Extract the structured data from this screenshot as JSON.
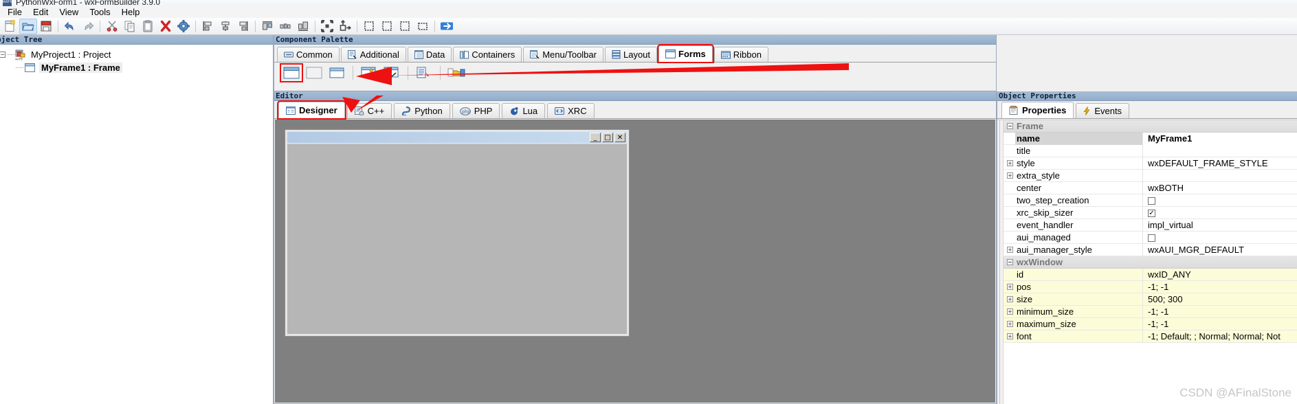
{
  "window": {
    "title": "PythonWxForm1 - wxFormBuilder 3.9.0",
    "app_icon": "wxfb-icon"
  },
  "menubar": {
    "items": [
      {
        "label": "File"
      },
      {
        "label": "Edit"
      },
      {
        "label": "View"
      },
      {
        "label": "Tools"
      },
      {
        "label": "Help"
      }
    ]
  },
  "toolbar": {
    "buttons": [
      {
        "name": "new-project",
        "icon": "new-document-icon",
        "selected": false
      },
      {
        "name": "open-project",
        "icon": "open-folder-icon",
        "selected": true
      },
      {
        "name": "save-project",
        "icon": "save-floppy-icon",
        "selected": false
      },
      {
        "name": "undo",
        "icon": "undo-arrow-icon",
        "selected": false
      },
      {
        "name": "redo",
        "icon": "redo-arrow-icon",
        "selected": false
      },
      {
        "name": "cut",
        "icon": "scissors-icon",
        "selected": false
      },
      {
        "name": "copy",
        "icon": "copy-icon",
        "selected": false
      },
      {
        "name": "paste",
        "icon": "clipboard-icon",
        "selected": false
      },
      {
        "name": "delete",
        "icon": "red-x-icon",
        "selected": false
      },
      {
        "name": "generate-code",
        "icon": "gear-icon",
        "selected": false
      },
      {
        "name": "align-left",
        "icon": "align-left-icon",
        "selected": false
      },
      {
        "name": "align-center-vertical",
        "icon": "align-center-vertical-icon",
        "selected": false
      },
      {
        "name": "align-right",
        "icon": "align-right-icon",
        "selected": false
      },
      {
        "name": "align-top",
        "icon": "align-top-icon",
        "selected": false
      },
      {
        "name": "align-center-horizontal",
        "icon": "align-center-horizontal-icon",
        "selected": false
      },
      {
        "name": "align-bottom",
        "icon": "align-bottom-icon",
        "selected": false
      },
      {
        "name": "expand-all",
        "icon": "expand-arrows-icon",
        "selected": false
      },
      {
        "name": "move-up",
        "icon": "move-object-icon",
        "selected": false
      },
      {
        "name": "border-left",
        "icon": "dotted-border-left-icon",
        "selected": false
      },
      {
        "name": "border-right",
        "icon": "dotted-border-right-icon",
        "selected": false
      },
      {
        "name": "border-top",
        "icon": "dotted-border-top-icon",
        "selected": false
      },
      {
        "name": "border-bottom",
        "icon": "dotted-border-bottom-icon",
        "selected": false
      },
      {
        "name": "preview-form",
        "icon": "blue-arrow-icon",
        "selected": false
      }
    ]
  },
  "object_tree": {
    "caption": "bject Tree",
    "nodes": [
      {
        "label": "MyProject1 : Project",
        "icon": "wxfb-project-icon",
        "expanded": true,
        "selected": false
      },
      {
        "label": "MyFrame1 : Frame",
        "icon": "frame-icon",
        "expanded": false,
        "selected": true
      }
    ]
  },
  "component_palette": {
    "caption": "Component Palette",
    "tabs": [
      {
        "label": "Common",
        "icon": "common-icon",
        "active": false,
        "highlighted": false
      },
      {
        "label": "Additional",
        "icon": "additional-icon",
        "active": false,
        "highlighted": false
      },
      {
        "label": "Data",
        "icon": "data-icon",
        "active": false,
        "highlighted": false
      },
      {
        "label": "Containers",
        "icon": "containers-icon",
        "active": false,
        "highlighted": false
      },
      {
        "label": "Menu/Toolbar",
        "icon": "menu-toolbar-icon",
        "active": false,
        "highlighted": false
      },
      {
        "label": "Layout",
        "icon": "layout-icon",
        "active": false,
        "highlighted": false
      },
      {
        "label": "Forms",
        "icon": "forms-icon",
        "active": true,
        "highlighted": true
      },
      {
        "label": "Ribbon",
        "icon": "ribbon-icon",
        "active": false,
        "highlighted": false
      }
    ],
    "tools": [
      {
        "name": "wxFrame",
        "icon": "frame-window-icon",
        "highlighted": true
      },
      {
        "name": "wxPanel",
        "icon": "panel-icon",
        "highlighted": false
      },
      {
        "name": "wxDialog",
        "icon": "dialog-icon",
        "highlighted": false
      },
      {
        "name": "wxWizard",
        "icon": "wizard-icon",
        "highlighted": false
      },
      {
        "name": "wxWizardPage",
        "icon": "wizard-page-icon",
        "highlighted": false
      },
      {
        "name": "wxMenuBar",
        "icon": "menubar-pick-icon",
        "highlighted": false
      },
      {
        "name": "wxFilePickerCtrl",
        "icon": "file-picker-icon",
        "highlighted": false
      }
    ]
  },
  "editor": {
    "caption": "Editor",
    "tabs": [
      {
        "label": "Designer",
        "icon": "designer-icon",
        "active": true,
        "highlighted": true
      },
      {
        "label": "C++",
        "icon": "cpp-icon",
        "active": false,
        "highlighted": false
      },
      {
        "label": "Python",
        "icon": "python-icon",
        "active": false,
        "highlighted": false
      },
      {
        "label": "PHP",
        "icon": "php-icon",
        "active": false,
        "highlighted": false
      },
      {
        "label": "Lua",
        "icon": "lua-icon",
        "active": false,
        "highlighted": false
      },
      {
        "label": "XRC",
        "icon": "xrc-icon",
        "active": false,
        "highlighted": false
      }
    ],
    "preview": {
      "title": "",
      "minimize_label": "_",
      "maximize_label": "□",
      "close_label": "✕"
    }
  },
  "object_properties": {
    "caption": "Object Properties",
    "tabs": [
      {
        "label": "Properties",
        "icon": "properties-icon",
        "active": true
      },
      {
        "label": "Events",
        "icon": "events-lightning-icon",
        "active": false
      }
    ],
    "rows": [
      {
        "kind": "category",
        "name": "Frame",
        "expander": "minus"
      },
      {
        "kind": "prop",
        "name": "name",
        "value": "MyFrame1",
        "expander": "none",
        "selected": true,
        "yellow": false,
        "control": "text"
      },
      {
        "kind": "prop",
        "name": "title",
        "value": "",
        "expander": "none",
        "selected": false,
        "yellow": false,
        "control": "text"
      },
      {
        "kind": "prop",
        "name": "style",
        "value": "wxDEFAULT_FRAME_STYLE",
        "expander": "plus",
        "selected": false,
        "yellow": false,
        "control": "text"
      },
      {
        "kind": "prop",
        "name": "extra_style",
        "value": "",
        "expander": "plus",
        "selected": false,
        "yellow": false,
        "control": "text"
      },
      {
        "kind": "prop",
        "name": "center",
        "value": "wxBOTH",
        "expander": "none",
        "selected": false,
        "yellow": false,
        "control": "text"
      },
      {
        "kind": "prop",
        "name": "two_step_creation",
        "value": "",
        "expander": "none",
        "selected": false,
        "yellow": false,
        "control": "checkbox",
        "checked": false
      },
      {
        "kind": "prop",
        "name": "xrc_skip_sizer",
        "value": "",
        "expander": "none",
        "selected": false,
        "yellow": false,
        "control": "checkbox",
        "checked": true
      },
      {
        "kind": "prop",
        "name": "event_handler",
        "value": "impl_virtual",
        "expander": "none",
        "selected": false,
        "yellow": false,
        "control": "text"
      },
      {
        "kind": "prop",
        "name": "aui_managed",
        "value": "",
        "expander": "none",
        "selected": false,
        "yellow": false,
        "control": "checkbox",
        "checked": false
      },
      {
        "kind": "prop",
        "name": "aui_manager_style",
        "value": "wxAUI_MGR_DEFAULT",
        "expander": "plus",
        "selected": false,
        "yellow": false,
        "control": "text"
      },
      {
        "kind": "category",
        "name": "wxWindow",
        "expander": "minus"
      },
      {
        "kind": "prop",
        "name": "id",
        "value": "wxID_ANY",
        "expander": "none",
        "selected": false,
        "yellow": true,
        "control": "text"
      },
      {
        "kind": "prop",
        "name": "pos",
        "value": "-1; -1",
        "expander": "plus",
        "selected": false,
        "yellow": true,
        "control": "text"
      },
      {
        "kind": "prop",
        "name": "size",
        "value": "500; 300",
        "expander": "plus",
        "selected": false,
        "yellow": true,
        "control": "text"
      },
      {
        "kind": "prop",
        "name": "minimum_size",
        "value": "-1; -1",
        "expander": "plus",
        "selected": false,
        "yellow": true,
        "control": "text"
      },
      {
        "kind": "prop",
        "name": "maximum_size",
        "value": "-1; -1",
        "expander": "plus",
        "selected": false,
        "yellow": true,
        "control": "text"
      },
      {
        "kind": "prop",
        "name": "font",
        "value": "-1; Default; ; Normal; Normal; Not",
        "expander": "plus",
        "selected": false,
        "yellow": true,
        "control": "text"
      }
    ]
  },
  "annotations": {
    "arrow_to_forms_tool": "red-arrow-pointing-to-wxframe-tool",
    "arrow_to_editor": "red-arrow-pointing-to-editor-caption",
    "highlight_color": "#ee1111"
  },
  "watermark": {
    "text": "CSDN @AFinalStone"
  },
  "colors": {
    "accent": "#3b6ea5",
    "panel_caption_bg": "#9cb3ce",
    "canvas_bg": "#808080",
    "highlight_red": "#ee1111",
    "yellow_row": "#fdfcd9"
  }
}
